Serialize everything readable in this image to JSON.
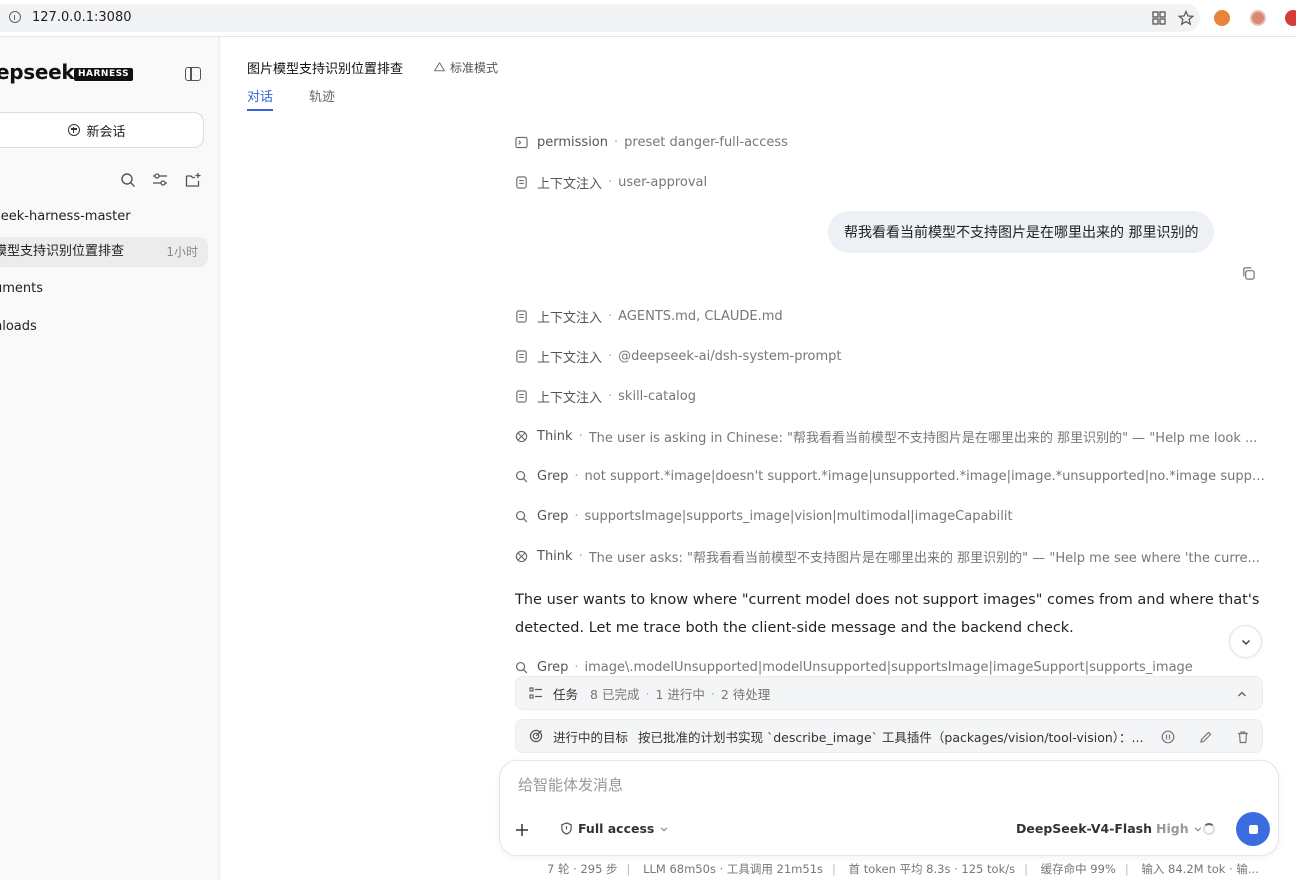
{
  "browser": {
    "url": "127.0.0.1:3080"
  },
  "sidebar": {
    "logo_text": "epseek",
    "badge": "HARNESS",
    "new_chat_label": "新会话",
    "items": [
      {
        "label": "seek-harness-master",
        "time": ""
      },
      {
        "label": "模型支持识别位置排查",
        "time": "1小时"
      },
      {
        "label": "uments",
        "time": ""
      },
      {
        "label": "nloads",
        "time": ""
      }
    ]
  },
  "header": {
    "title": "图片模型支持识别位置排查",
    "mode": "标准模式",
    "tabs": [
      {
        "label": "对话"
      },
      {
        "label": "轨迹"
      }
    ]
  },
  "log": {
    "rows_top": [
      {
        "icon": "terminal-icon",
        "k": "permission",
        "v": "preset danger-full-access"
      },
      {
        "icon": "document-icon",
        "k": "上下文注入",
        "v": "user-approval"
      }
    ],
    "user_message": "帮我看看当前模型不支持图片是在哪里出来的 那里识别的",
    "rows_bottom": [
      {
        "icon": "document-icon",
        "k": "上下文注入",
        "v": "AGENTS.md, CLAUDE.md"
      },
      {
        "icon": "document-icon",
        "k": "上下文注入",
        "v": "@deepseek-ai/dsh-system-prompt"
      },
      {
        "icon": "document-icon",
        "k": "上下文注入",
        "v": "skill-catalog"
      },
      {
        "icon": "think-icon",
        "k": "Think",
        "v": "The user is asking in Chinese: \"帮我看看当前模型不支持图片是在哪里出来的 那里识别的\" — \"Help me look ..."
      },
      {
        "icon": "search-icon",
        "k": "Grep",
        "v": "not support.*image|doesn't support.*image|unsupported.*image|image.*unsupported|no.*image support"
      },
      {
        "icon": "search-icon",
        "k": "Grep",
        "v": "supportsImage|supports_image|vision|multimodal|imageCapabilit"
      },
      {
        "icon": "think-icon",
        "k": "Think",
        "v": "The user asks: \"帮我看看当前模型不支持图片是在哪里出来的 那里识别的\" — \"Help me see where 'the curre..."
      }
    ],
    "assistant_text": "The user wants to know where \"current model does not support images\" comes from and where that's detected. Let me trace both the client-side message and the backend check.",
    "row_partial": {
      "icon": "search-icon",
      "k": "Grep",
      "v": "image\\.modelUnsupported|modelUnsupported|supportsImage|imageSupport|supports_image"
    }
  },
  "tasks": {
    "label": "任务",
    "done": "8 已完成",
    "running": "1 进行中",
    "pending": "2 待处理"
  },
  "goal": {
    "label": "进行中的目标",
    "text": "按已批准的计划书实现 `describe_image` 工具插件（packages/vision/tool-vision）：..."
  },
  "composer": {
    "placeholder": "给智能体发消息",
    "access": "Full access",
    "model": "DeepSeek-V4-Flash",
    "level": "High"
  },
  "status": {
    "items": [
      "7 轮 · 295 步",
      "LLM 68m50s · 工具调用 21m51s",
      "首 token 平均 8.3s · 125 tok/s",
      "缓存命中 99%",
      "输入 84.2M tok · 输..."
    ]
  }
}
